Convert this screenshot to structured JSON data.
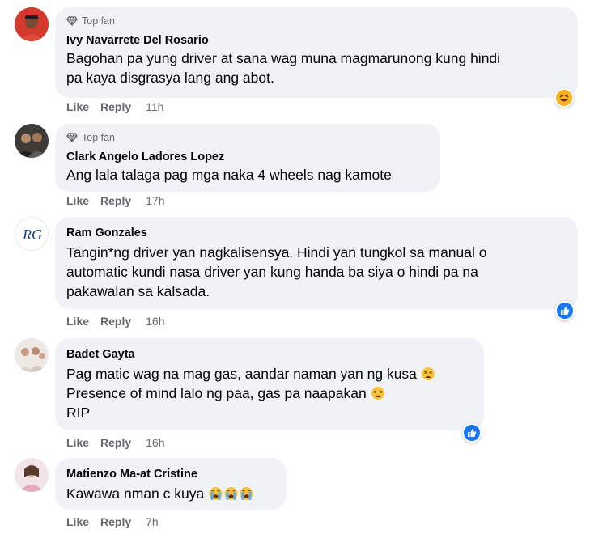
{
  "top_fan_label": "Top fan",
  "action_like": "Like",
  "action_reply": "Reply",
  "comments": [
    {
      "name": "Ivy Navarrete Del Rosario",
      "lines": [
        "Bagohan pa yung driver at sana wag muna magmarunong kung hindi",
        "pa kaya disgrasya lang ang abot."
      ],
      "time": "11h",
      "reaction": "haha"
    },
    {
      "name": "Clark Angelo Ladores Lopez",
      "lines": [
        "Ang lala talaga pag mga naka 4 wheels nag kamote"
      ],
      "time": "17h"
    },
    {
      "name": "Ram Gonzales",
      "lines": [
        "Tangin*ng driver yan nagkalisensya. Hindi yan tungkol sa manual o",
        "automatic kundi nasa driver yan kung handa ba siya o hindi pa na",
        "pakawalan sa kalsada."
      ],
      "time": "16h",
      "reaction": "like",
      "avatar_text": "RG"
    },
    {
      "name": "Badet Gayta",
      "lines": [
        "Pag matic wag na mag gas, aandar naman yan ng kusa",
        "Presence of mind lalo ng paa, gas pa naapakan",
        "RIP"
      ],
      "time": "16h",
      "reaction": "like"
    },
    {
      "name": "Matienzo Ma-at Cristine",
      "lines": [
        "Kawawa nman c kuya"
      ],
      "time": "7h"
    }
  ],
  "colors": {
    "bubble": "#f0f2f5",
    "secondary_text": "#65676b",
    "like_blue": "#1877f2",
    "haha_yellow": "#f7b125"
  }
}
